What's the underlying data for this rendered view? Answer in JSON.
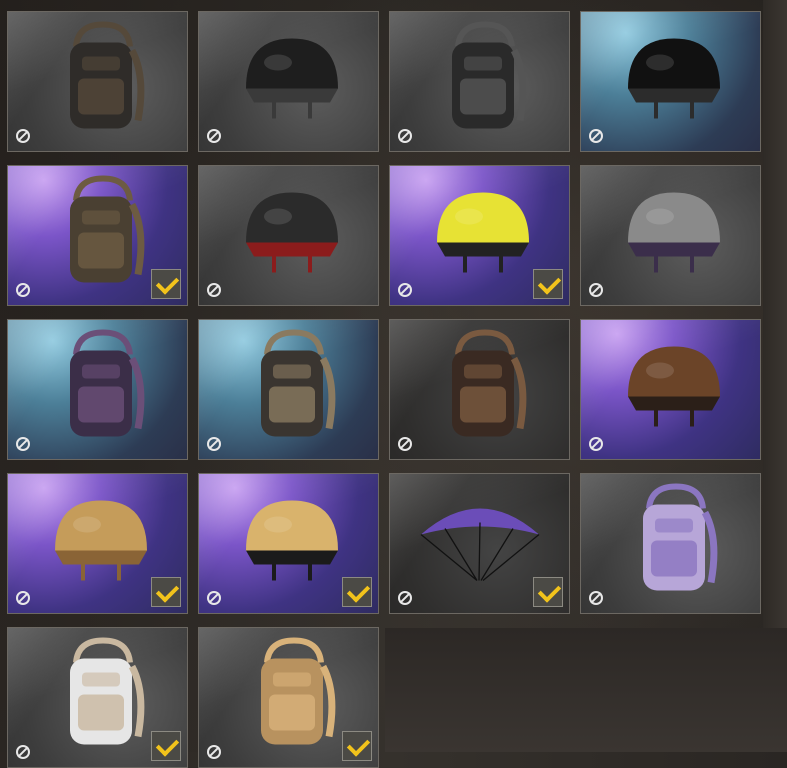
{
  "inventory": {
    "items": [
      {
        "type": "backpack",
        "rarity": "common",
        "equipped": false
      },
      {
        "type": "helmet",
        "rarity": "common",
        "equipped": false
      },
      {
        "type": "backpack",
        "rarity": "common",
        "equipped": false
      },
      {
        "type": "helmet",
        "rarity": "blue",
        "equipped": false
      },
      {
        "type": "backpack",
        "rarity": "purple",
        "equipped": true
      },
      {
        "type": "helmet",
        "rarity": "common",
        "equipped": false
      },
      {
        "type": "helmet",
        "rarity": "purple",
        "equipped": true
      },
      {
        "type": "helmet",
        "rarity": "common",
        "equipped": false
      },
      {
        "type": "backpack",
        "rarity": "blue",
        "equipped": false
      },
      {
        "type": "backpack",
        "rarity": "blue",
        "equipped": false
      },
      {
        "type": "backpack",
        "rarity": "dark",
        "equipped": false
      },
      {
        "type": "helmet",
        "rarity": "purple",
        "equipped": false
      },
      {
        "type": "helmet",
        "rarity": "purple",
        "equipped": true
      },
      {
        "type": "helmet",
        "rarity": "purple",
        "equipped": true
      },
      {
        "type": "parachute",
        "rarity": "dark",
        "equipped": true
      },
      {
        "type": "backpack",
        "rarity": "common",
        "equipped": false
      },
      {
        "type": "backpack",
        "rarity": "common",
        "equipped": true
      },
      {
        "type": "backpack",
        "rarity": "common",
        "equipped": true
      }
    ]
  },
  "colors": {
    "check_accent": "#f2c31b",
    "tile_border": "#6c6862",
    "purple_rarity": "#7b55c8",
    "blue_rarity": "#4c7f98"
  },
  "icons": {
    "unavailable": "ban-icon",
    "equipped": "checkmark-icon"
  }
}
